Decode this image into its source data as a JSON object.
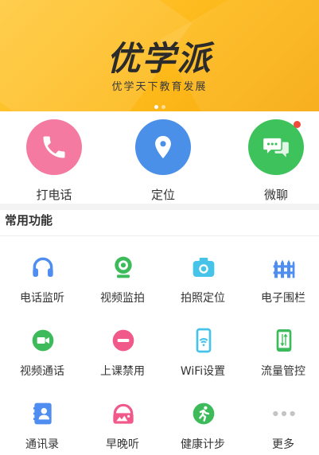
{
  "banner": {
    "title": "优学派",
    "subtitle": "优学天下教育发展"
  },
  "quick_actions": [
    {
      "label": "打电话",
      "icon": "phone-icon",
      "color": "#f47aa2"
    },
    {
      "label": "定位",
      "icon": "location-pin-icon",
      "color": "#4a8fe8"
    },
    {
      "label": "微聊",
      "icon": "chat-icon",
      "color": "#3dc25c"
    }
  ],
  "section": {
    "title": "常用功能"
  },
  "features": [
    {
      "label": "电话监听",
      "icon": "headphones-icon",
      "color": "#4f8ef0"
    },
    {
      "label": "视频监拍",
      "icon": "webcam-icon",
      "color": "#3dbb5a"
    },
    {
      "label": "拍照定位",
      "icon": "camera-icon",
      "color": "#46c3e8"
    },
    {
      "label": "电子围栏",
      "icon": "fence-icon",
      "color": "#4f8ef0"
    },
    {
      "label": "视频通话",
      "icon": "video-call-icon",
      "color": "#3dbb5a"
    },
    {
      "label": "上课禁用",
      "icon": "no-entry-icon",
      "color": "#f0598a"
    },
    {
      "label": "WiFi设置",
      "icon": "wifi-phone-icon",
      "color": "#46c3e8"
    },
    {
      "label": "流量管控",
      "icon": "data-traffic-icon",
      "color": "#3dbb5a"
    },
    {
      "label": "通讯录",
      "icon": "contacts-icon",
      "color": "#4f8ef0"
    },
    {
      "label": "早晚听",
      "icon": "radio-headset-icon",
      "color": "#f0598a"
    },
    {
      "label": "健康计步",
      "icon": "runner-icon",
      "color": "#3dbb5a"
    },
    {
      "label": "更多",
      "icon": "more-dots-icon",
      "color": "#c4c4c4"
    }
  ]
}
